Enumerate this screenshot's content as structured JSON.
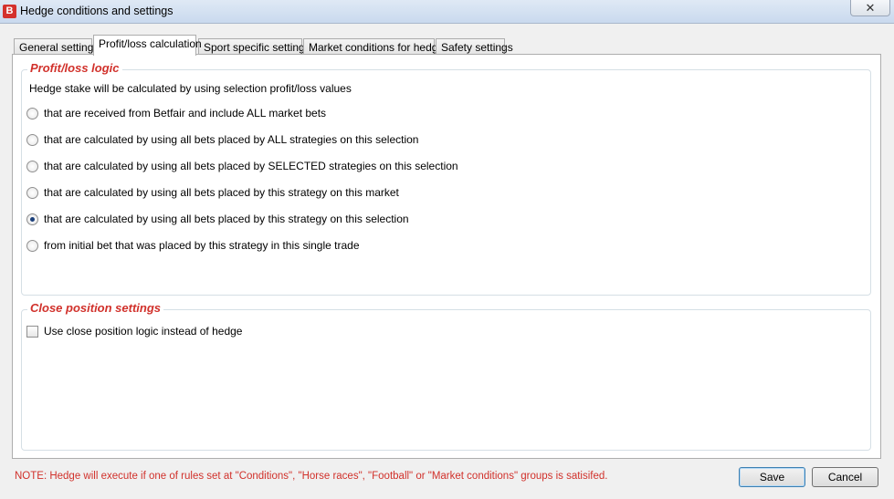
{
  "window": {
    "title": "Hedge conditions and settings",
    "close_glyph": "✕",
    "app_icon_letter": "B"
  },
  "tabs": [
    {
      "label": "General settings",
      "active": false
    },
    {
      "label": "Profit/loss calculation",
      "active": true
    },
    {
      "label": "Sport specific settings",
      "active": false
    },
    {
      "label": "Market conditions for hedge",
      "active": false
    },
    {
      "label": "Safety settings",
      "active": false
    }
  ],
  "profit_loss": {
    "title": "Profit/loss logic",
    "description": "Hedge stake will be calculated by using selection profit/loss values",
    "options": [
      {
        "label": "that are received from Betfair and include ALL market bets",
        "checked": false
      },
      {
        "label": "that are calculated by using all bets placed by ALL strategies on this selection",
        "checked": false
      },
      {
        "label": "that are calculated by using all bets placed by SELECTED strategies on this selection",
        "checked": false
      },
      {
        "label": "that are calculated by using all bets placed by this strategy on this market",
        "checked": false
      },
      {
        "label": "that are calculated by using all bets placed by this strategy on this selection",
        "checked": true
      },
      {
        "label": "from initial bet that was placed by this strategy in this single trade",
        "checked": false
      }
    ]
  },
  "close_position": {
    "title": "Close position settings",
    "checkbox_label": "Use close position logic instead of hedge",
    "checked": false
  },
  "footer": {
    "note": "NOTE: Hedge will execute if one of rules set at \"Conditions\", \"Horse races\", \"Football\" or \"Market conditions\" groups is satisifed.",
    "save_label": "Save",
    "cancel_label": "Cancel"
  },
  "colors": {
    "accent_red": "#d1312b",
    "app_icon": "#d4312d"
  }
}
